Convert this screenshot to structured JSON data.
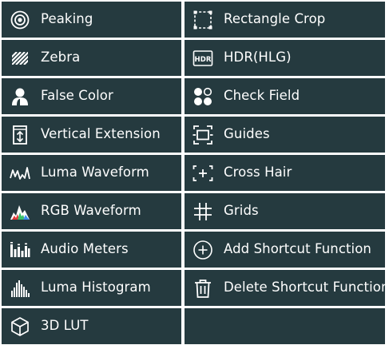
{
  "menu": {
    "left": [
      {
        "label": "Peaking",
        "icon": "peaking-icon"
      },
      {
        "label": "Zebra",
        "icon": "zebra-icon"
      },
      {
        "label": "False Color",
        "icon": "false-color-icon"
      },
      {
        "label": "Vertical Extension",
        "icon": "vertical-extension-icon"
      },
      {
        "label": "Luma Waveform",
        "icon": "luma-waveform-icon"
      },
      {
        "label": "RGB Waveform",
        "icon": "rgb-waveform-icon"
      },
      {
        "label": "Audio Meters",
        "icon": "audio-meters-icon"
      },
      {
        "label": "Luma Histogram",
        "icon": "luma-histogram-icon"
      },
      {
        "label": "3D LUT",
        "icon": "3d-lut-icon"
      }
    ],
    "right": [
      {
        "label": "Rectangle Crop",
        "icon": "rectangle-crop-icon"
      },
      {
        "label": "HDR(HLG)",
        "icon": "hdr-icon",
        "icon_text": "HDR"
      },
      {
        "label": "Check Field",
        "icon": "check-field-icon"
      },
      {
        "label": "Guides",
        "icon": "guides-icon"
      },
      {
        "label": "Cross Hair",
        "icon": "cross-hair-icon"
      },
      {
        "label": "Grids",
        "icon": "grids-icon"
      },
      {
        "label": "Add Shortcut Function",
        "icon": "add-icon"
      },
      {
        "label": "Delete Shortcut Function",
        "icon": "trash-icon"
      }
    ]
  },
  "colors": {
    "tile_background": "#253a3f",
    "text": "#ffffff"
  }
}
